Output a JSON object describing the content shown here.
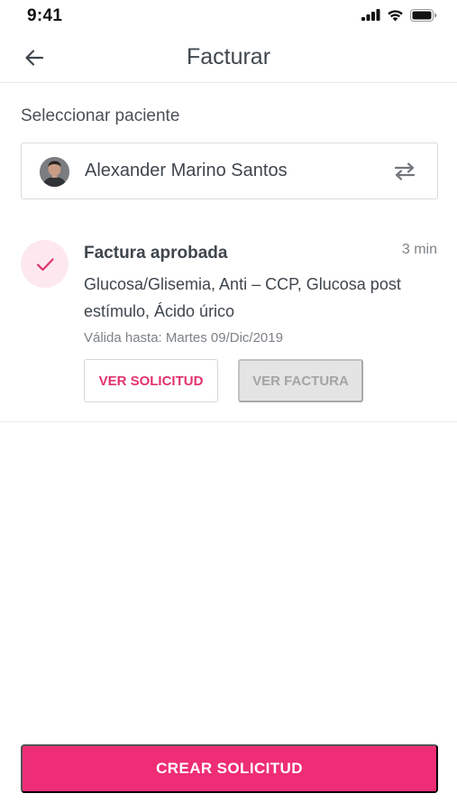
{
  "status_bar": {
    "time": "9:41"
  },
  "header": {
    "title": "Facturar"
  },
  "patient": {
    "section_label": "Seleccionar paciente",
    "name": "Alexander Marino Santos"
  },
  "invoice": {
    "title": "Factura aprobada",
    "time_ago": "3 min",
    "description": "Glucosa/Glisemia, Anti – CCP, Glucosa post estímulo, Ácido úrico",
    "valid_until": "Válida hasta: Martes 09/Dic/2019",
    "view_request_label": "VER SOLICITUD",
    "view_invoice_label": "VER FACTURA"
  },
  "actions": {
    "create_request_label": "CREAR SOLICITUD"
  },
  "colors": {
    "accent": "#ee2d76",
    "accent_text": "#e2326f",
    "status_circle_bg": "#fde8f0",
    "disabled_bg": "#e4e4e4"
  },
  "icons": {
    "back": "arrow-left-icon",
    "swap": "swap-arrows-icon",
    "approved": "check-icon",
    "signal": "cellular-signal-icon",
    "wifi": "wifi-icon",
    "battery": "battery-icon"
  }
}
